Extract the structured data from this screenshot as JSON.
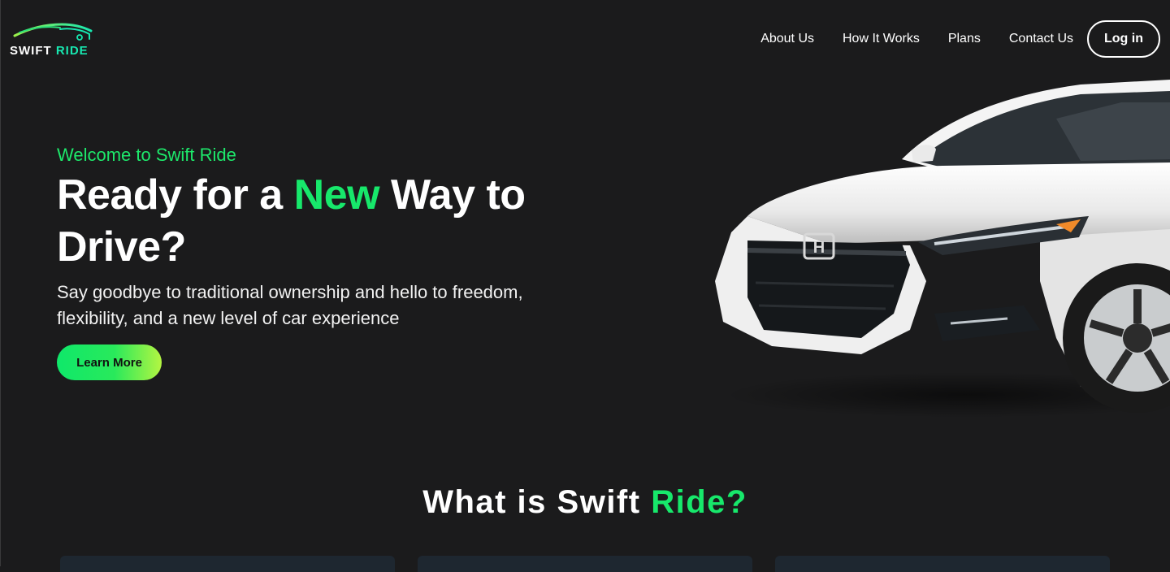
{
  "brand": {
    "logo_word1": "SWIFT",
    "logo_word2": "RIDE",
    "accent_color": "#17e86b",
    "logo_accent": "#17e8b0"
  },
  "nav": {
    "items": [
      {
        "label": "About Us"
      },
      {
        "label": "How It Works"
      },
      {
        "label": "Plans"
      },
      {
        "label": "Contact Us"
      }
    ],
    "login_label": "Log in"
  },
  "hero": {
    "welcome": "Welcome to Swift Ride",
    "headline_part1": "Ready for a ",
    "headline_accent": "New",
    "headline_part2": " Way to Drive?",
    "subtext": "Say goodbye to traditional ownership and hello to freedom, flexibility, and a new level of car experience",
    "cta_label": "Learn More"
  },
  "section": {
    "title_part1": "What is Swift ",
    "title_accent": "Ride?"
  },
  "icons": {
    "logo": "car-silhouette-icon",
    "car_image": "white-sedan-image"
  }
}
